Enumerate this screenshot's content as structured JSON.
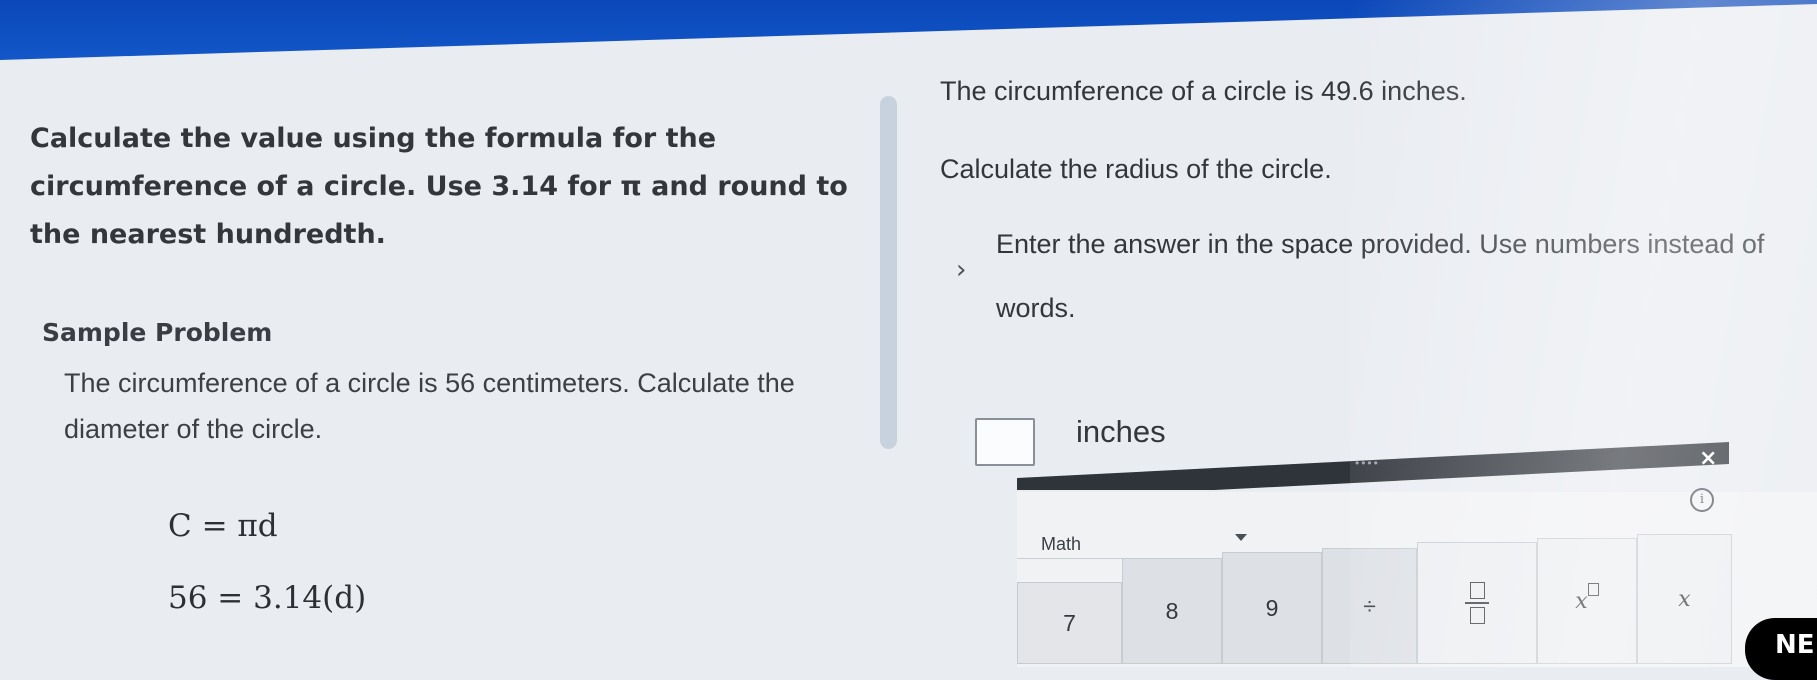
{
  "left": {
    "instruction": "Calculate the value using the formula for the circumference of a circle. Use 3.14 for π and round to the nearest hundredth.",
    "sample_title": "Sample Problem",
    "sample_text": "The circumference of a circle is 56 centimeters. Calculate the diameter of the circle.",
    "equations": [
      "C = πd",
      "56 = 3.14(d)"
    ]
  },
  "right": {
    "question_line1": "The circumference of a circle is 49.6 inches.",
    "question_line2": "Calculate the radius of the circle.",
    "hint_icon": "chevron-right-icon",
    "hint": "Enter the answer in the space provided. Use numbers instead of words.",
    "answer_value": "",
    "unit": "inches"
  },
  "keypad": {
    "close_icon": "×",
    "grip_icon": "••••",
    "info_icon": "i",
    "mode": "Math",
    "keys": [
      "7",
      "8",
      "9",
      "÷",
      "x"
    ],
    "fraction_key_icon": "fraction-template-icon",
    "exponent_key_label": "x"
  },
  "footer": {
    "next_label": "NE"
  },
  "colors": {
    "top_bar": "#1257c9",
    "keypad_header": "#2f333a",
    "next_button": "#000000"
  }
}
